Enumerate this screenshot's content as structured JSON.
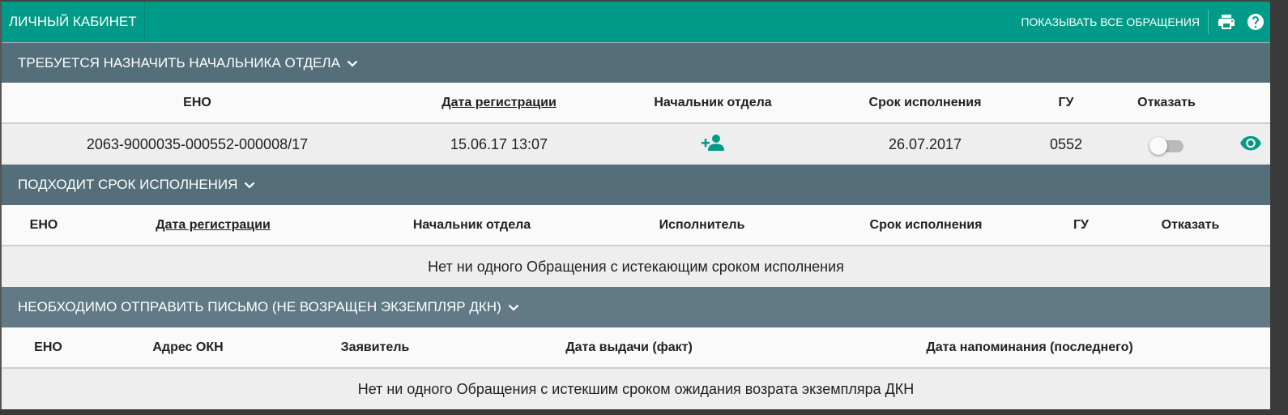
{
  "app": {
    "title": "ЛИЧНЫЙ КАБИНЕТ",
    "show_all_label": "ПОКАЗЫВАТЬ ВСЕ ОБРАЩЕНИЯ",
    "print_icon": "print-icon",
    "help_icon": "help-icon",
    "accent_color": "#009a88"
  },
  "section1": {
    "title": "ТРЕБУЕТСЯ НАЗНАЧИТЬ НАЧАЛЬНИКА ОТДЕЛА",
    "columns": [
      "ЕНО",
      "Дата регистрации",
      "Начальник отдела",
      "Срок исполнения",
      "ГУ",
      "Отказать"
    ],
    "rows": [
      {
        "eno": "2063-9000035-000552-000008/17",
        "reg_date": "15.06.17 13:07",
        "head_icon": "person-add-icon",
        "deadline": "26.07.2017",
        "gu": "0552",
        "refuse": false,
        "view_icon": "eye-icon"
      }
    ]
  },
  "section2": {
    "title": "ПОДХОДИТ СРОК ИСПОЛНЕНИЯ",
    "columns": [
      "ЕНО",
      "Дата регистрации",
      "Начальник отдела",
      "Исполнитель",
      "Срок исполнения",
      "ГУ",
      "Отказать"
    ],
    "empty_text": "Нет ни одного Обращения с истекающим сроком исполнения"
  },
  "section3": {
    "title": "НЕОБХОДИМО ОТПРАВИТЬ ПИСЬМО (НЕ ВОЗРАЩЕН ЭКЗЕМПЛЯР ДКН)",
    "columns": [
      "ЕНО",
      "Адрес ОКН",
      "Заявитель",
      "Дата выдачи (факт)",
      "Дата напоминания (последнего)"
    ],
    "empty_text": "Нет ни одного Обращения с истекшим сроком ожидания возрата экземпляра ДКН"
  }
}
